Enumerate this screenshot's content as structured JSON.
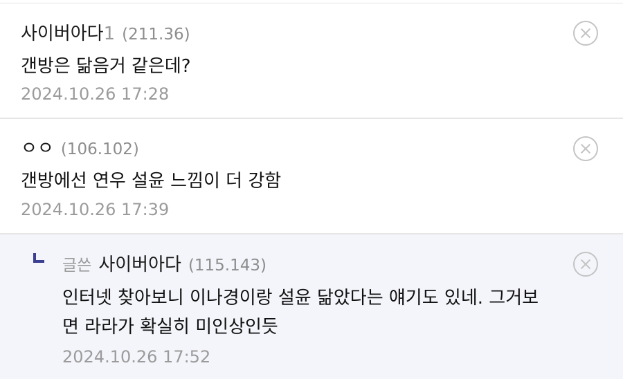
{
  "comments": [
    {
      "nick": "사이버아다",
      "nick_suffix": "1",
      "ip": "(211.36)",
      "text": "갠방은 닮음거 같은데?",
      "date": "2024.10.26 17:28"
    },
    {
      "nick": "ㅇㅇ",
      "ip": "(106.102)",
      "text": "갠방에선 연우 설윤 느낌이 더 강함",
      "date": "2024.10.26 17:39"
    }
  ],
  "reply": {
    "label": "글쓴",
    "nick": "사이버아다",
    "ip": "(115.143)",
    "text_line1": "인터넷 찾아보니 이나경이랑 설윤 닮았다는 얘기도 있네. 그거보",
    "text_line2": "면 라라가 확실히 미인상인듯",
    "date": "2024.10.26 17:52"
  },
  "icons": {
    "delete": "close-circle-icon",
    "reply": "reply-arrow-icon"
  }
}
